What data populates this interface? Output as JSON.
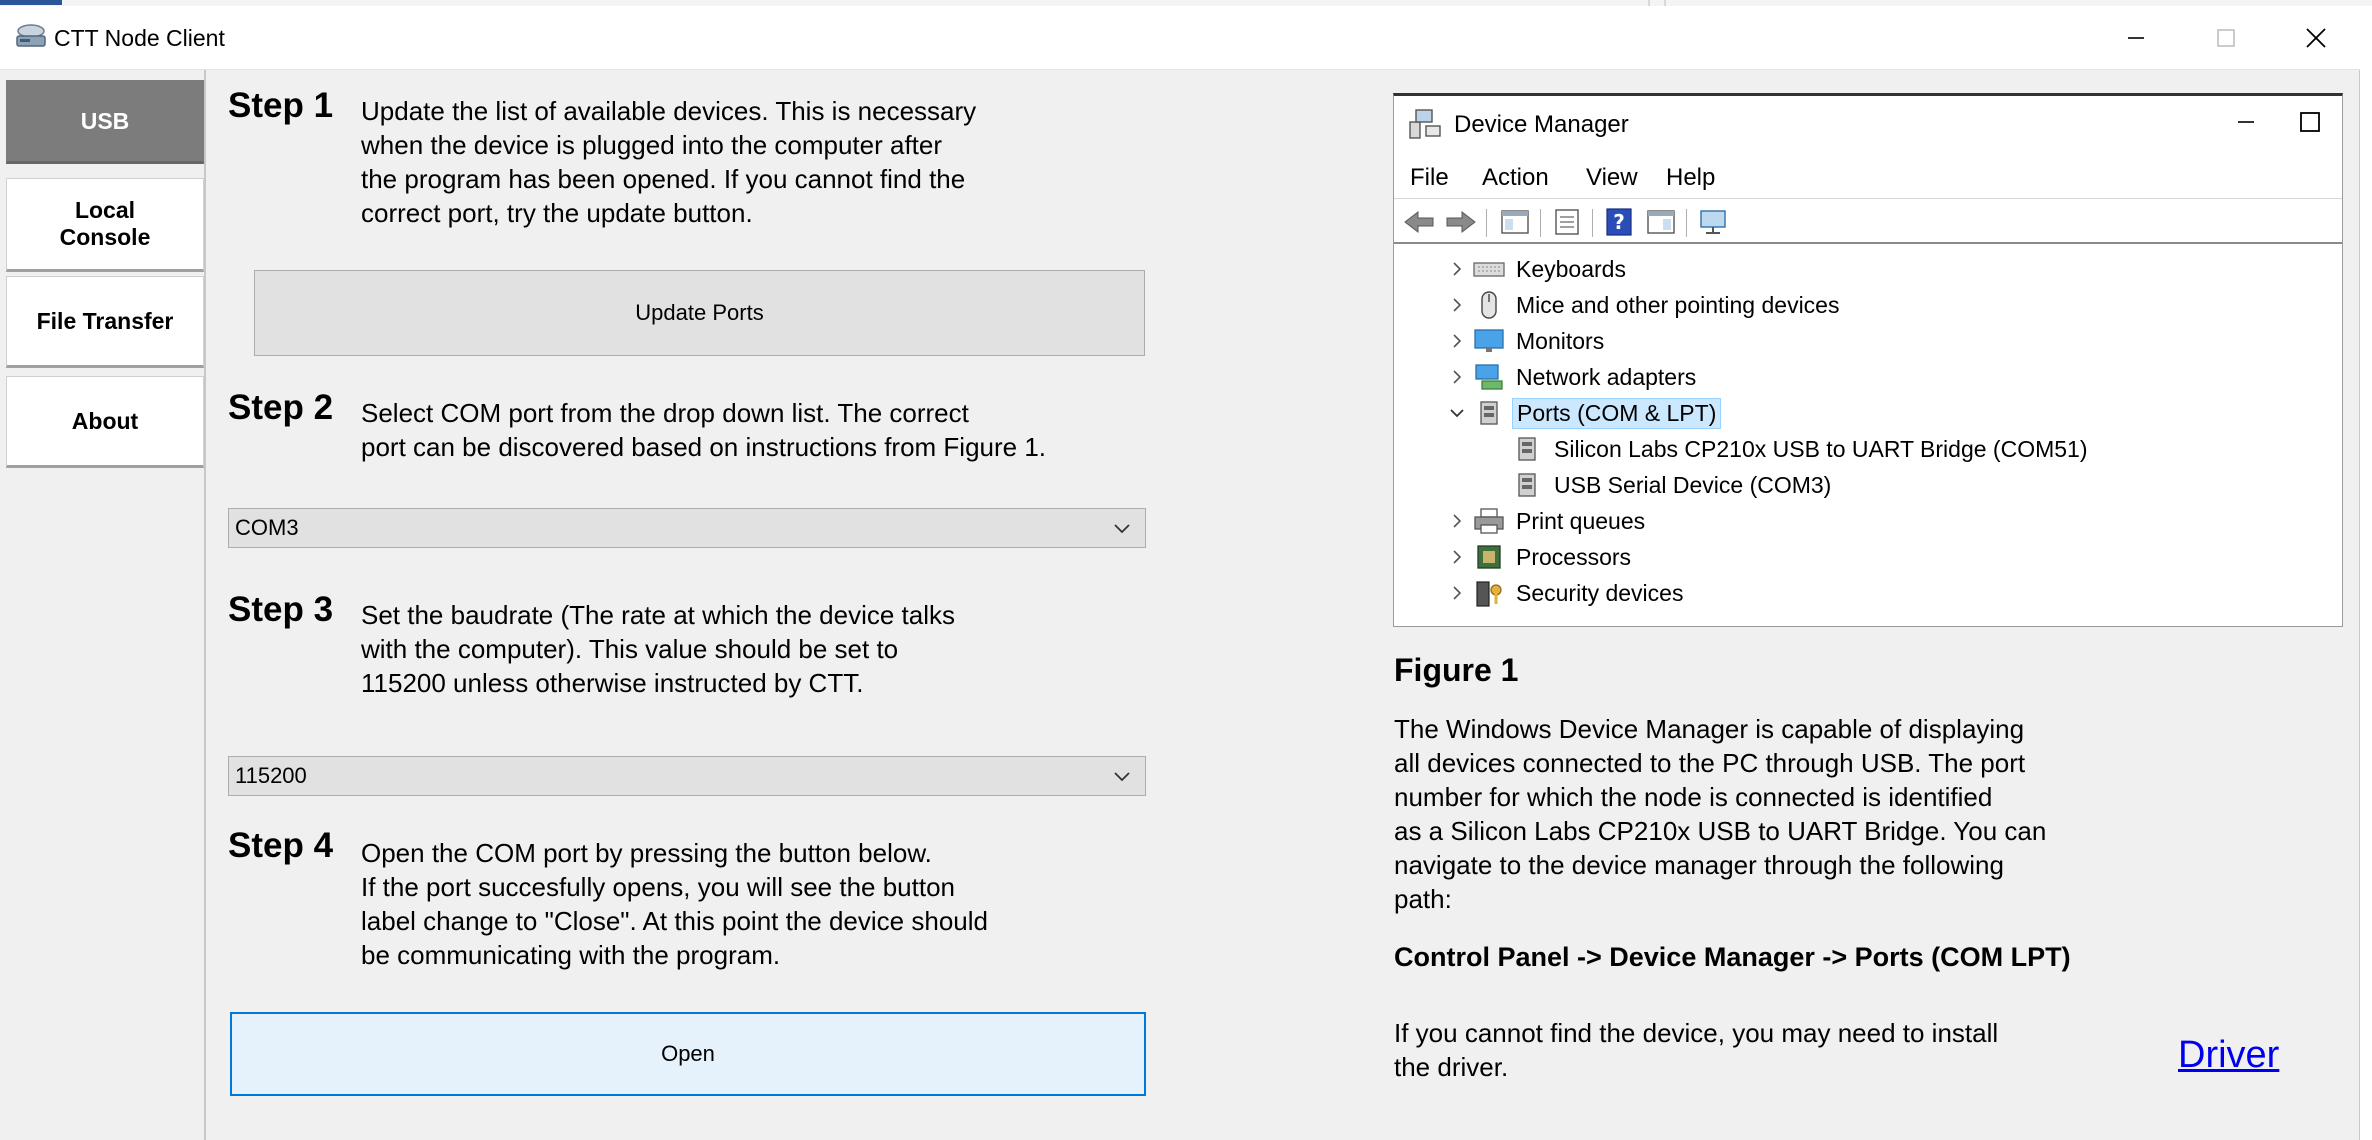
{
  "window": {
    "title": "CTT Node Client",
    "controls": {
      "minimize": "—",
      "maximize": "☐",
      "close": "✕"
    }
  },
  "sidebar": {
    "tabs": [
      {
        "label": "USB",
        "active": true
      },
      {
        "label": "Local\nConsole",
        "active": false
      },
      {
        "label": "File Transfer",
        "active": false
      },
      {
        "label": "About",
        "active": false
      }
    ]
  },
  "steps": [
    {
      "label": "Step 1",
      "text": "Update the list of available devices. This is necessary\nwhen the device is plugged into the computer after\nthe program has been opened. If you cannot find the\ncorrect port, try the update button."
    },
    {
      "label": "Step 2",
      "text": "Select COM port from the drop down list. The correct\nport can be discovered based on instructions from Figure 1."
    },
    {
      "label": "Step 3",
      "text": "Set the baudrate (The rate at which the device talks\nwith the computer). This value should be set to\n115200 unless otherwise instructed by CTT."
    },
    {
      "label": "Step 4",
      "text": "Open the COM port by pressing the button below.\nIf the port succesfully opens, you will see the button\nlabel change to \"Close\". At this point the device should\nbe communicating with the program."
    }
  ],
  "controls": {
    "update_ports_label": "Update Ports",
    "com_port_value": "COM3",
    "baudrate_value": "115200",
    "open_label": "Open"
  },
  "device_manager": {
    "title": "Device Manager",
    "menu": [
      "File",
      "Action",
      "View",
      "Help"
    ],
    "tree": [
      {
        "label": "Keyboards",
        "icon": "keyboard-icon",
        "expanded": false,
        "level": 0
      },
      {
        "label": "Mice and other pointing devices",
        "icon": "mouse-icon",
        "expanded": false,
        "level": 0
      },
      {
        "label": "Monitors",
        "icon": "monitor-icon",
        "expanded": false,
        "level": 0
      },
      {
        "label": "Network adapters",
        "icon": "network-icon",
        "expanded": false,
        "level": 0
      },
      {
        "label": "Ports (COM & LPT)",
        "icon": "port-icon",
        "expanded": true,
        "level": 0,
        "selected": true
      },
      {
        "label": "Silicon Labs CP210x USB to UART Bridge (COM51)",
        "icon": "port-icon",
        "level": 1
      },
      {
        "label": "USB Serial Device (COM3)",
        "icon": "port-icon",
        "level": 1
      },
      {
        "label": "Print queues",
        "icon": "printer-icon",
        "expanded": false,
        "level": 0
      },
      {
        "label": "Processors",
        "icon": "chip-icon",
        "expanded": false,
        "level": 0
      },
      {
        "label": "Security devices",
        "icon": "security-icon",
        "expanded": false,
        "level": 0
      }
    ]
  },
  "figure": {
    "title": "Figure 1",
    "text": "The Windows Device Manager is capable of displaying\nall devices connected to the PC through USB. The port\nnumber for which the node is connected is identified\nas a Silicon Labs CP210x USB to UART Bridge. You can\nnavigate to the device manager through the following\npath:",
    "path": "Control Panel -> Device Manager -> Ports (COM  LPT)",
    "note": "If you cannot find the device, you may need to install\nthe driver.",
    "driver_link": "Driver"
  },
  "colors": {
    "active_tab": "#7c7c7c",
    "open_button_border": "#0078d7",
    "open_button_bg": "#e5f1fb",
    "link": "#0000ee",
    "tree_selection": "#cce8ff"
  }
}
